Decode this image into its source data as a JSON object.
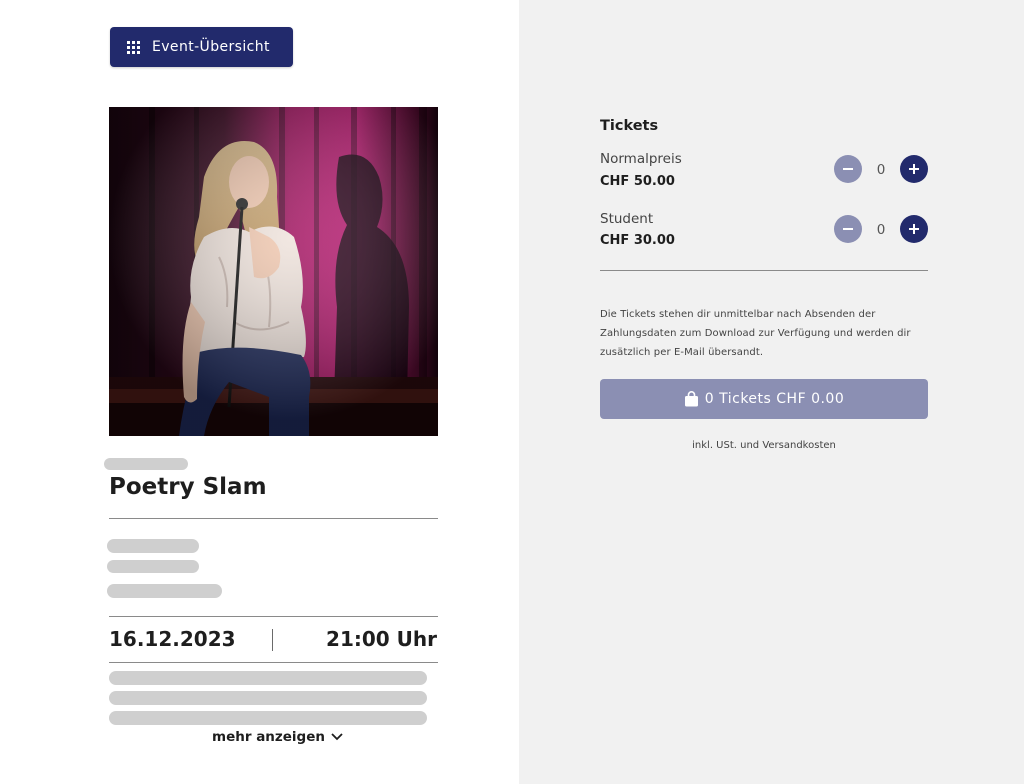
{
  "header": {
    "overview_button_label": "Event-Übersicht",
    "overview_icon": "grid-icon"
  },
  "event": {
    "image_alt": "Woman performing with microphone on stage in front of a magenta curtain",
    "title": "Poetry Slam",
    "date": "16.12.2023",
    "time": "21:00 Uhr",
    "more_label": "mehr anzeigen",
    "more_icon": "chevron-down-icon"
  },
  "tickets": {
    "heading": "Tickets",
    "items": [
      {
        "name": "Normalpreis",
        "price": "CHF 50.00",
        "quantity": "0"
      },
      {
        "name": "Student",
        "price": "CHF 30.00",
        "quantity": "0"
      }
    ],
    "info_text": "Die Tickets stehen dir unmittelbar nach Absenden der Zahlungsdaten zum Download zur Verfügung und werden dir zusätzlich per E-Mail übersandt.",
    "cart_button_label": "0 Tickets CHF 0.00",
    "cart_icon": "shopping-bag-icon",
    "note": "inkl. USt. und Versandkosten"
  },
  "colors": {
    "primary": "#222a6c",
    "primary_disabled": "#8b8fb3",
    "panel_background": "#f1f1f1",
    "skeleton": "#cfcfcf"
  }
}
